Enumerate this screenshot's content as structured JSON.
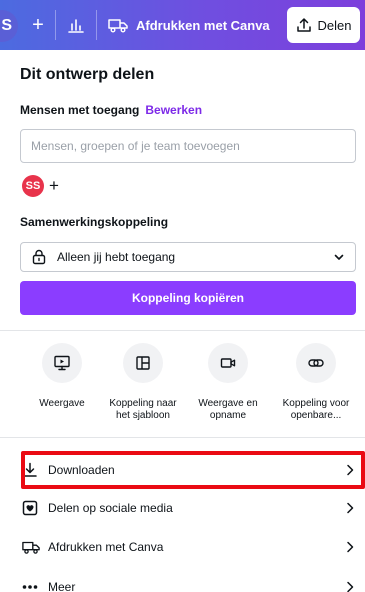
{
  "toolbar": {
    "avatar_initial": "S",
    "plus_glyph": "+",
    "chart_icon": "bar-chart-icon",
    "print_label": "Afdrukken met Canva",
    "print_icon": "truck-icon",
    "share_label": "Delen",
    "share_icon": "upload-icon",
    "gradient_colors": [
      "#4c6be0",
      "#7d3fdc"
    ]
  },
  "panel": {
    "title": "Dit ontwerp delen",
    "access": {
      "label": "Mensen met toegang",
      "edit_link": "Bewerken",
      "input_placeholder": "Mensen, groepen of je team toevoegen",
      "input_value": ""
    },
    "people": {
      "avatar_initials": "SS",
      "avatar_color": "#e8334b",
      "add_glyph": "+"
    },
    "collaboration": {
      "label": "Samenwerkingskoppeling",
      "selected_access": "Alleen jij hebt toegang",
      "lock_icon": "lock-icon",
      "chevron_icon": "chevron-down-icon"
    },
    "copy_button": {
      "label": "Koppeling kopiëren",
      "color": "#8b3dff"
    },
    "options": [
      {
        "label": "Weergave",
        "icon": "presentation-icon"
      },
      {
        "label": "Koppeling naar het sjabloon",
        "icon": "template-icon"
      },
      {
        "label": "Weergave en opname",
        "icon": "video-camera-icon"
      },
      {
        "label": "Koppeling voor openbare...",
        "icon": "link-icon"
      }
    ],
    "list": [
      {
        "label": "Downloaden",
        "icon": "download-icon",
        "highlighted": true
      },
      {
        "label": "Delen op sociale media",
        "icon": "heart-icon"
      },
      {
        "label": "Afdrukken met Canva",
        "icon": "truck-icon"
      },
      {
        "label": "Meer",
        "icon": "more-icon"
      }
    ],
    "highlight_color": "#ea0a13"
  }
}
